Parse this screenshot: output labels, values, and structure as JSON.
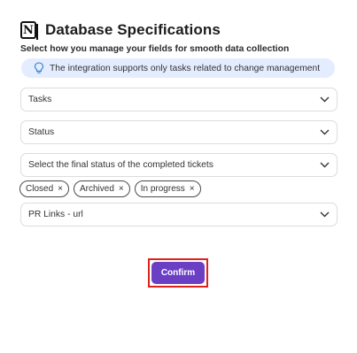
{
  "header": {
    "logo_icon": "notion-logo-icon",
    "logo_letter": "N",
    "title": "Database Specifications"
  },
  "subtitle": "Select how you manage your fields for smooth data collection",
  "info": {
    "icon": "lightbulb-icon",
    "text": "The integration supports only tasks related to change management",
    "background": "#e4edff"
  },
  "fields": {
    "tasks_select": "Tasks",
    "status_select": "Status",
    "final_status_select": "Select the final status of the completed tickets",
    "pr_links_select": "PR Links - url"
  },
  "chips": [
    {
      "label": "Closed",
      "remove": "×"
    },
    {
      "label": "Archived",
      "remove": "×"
    },
    {
      "label": "In progress",
      "remove": "×"
    }
  ],
  "confirm": {
    "label": "Confirm",
    "color": "#6a3fc4",
    "highlight_color": "#e0201c"
  }
}
